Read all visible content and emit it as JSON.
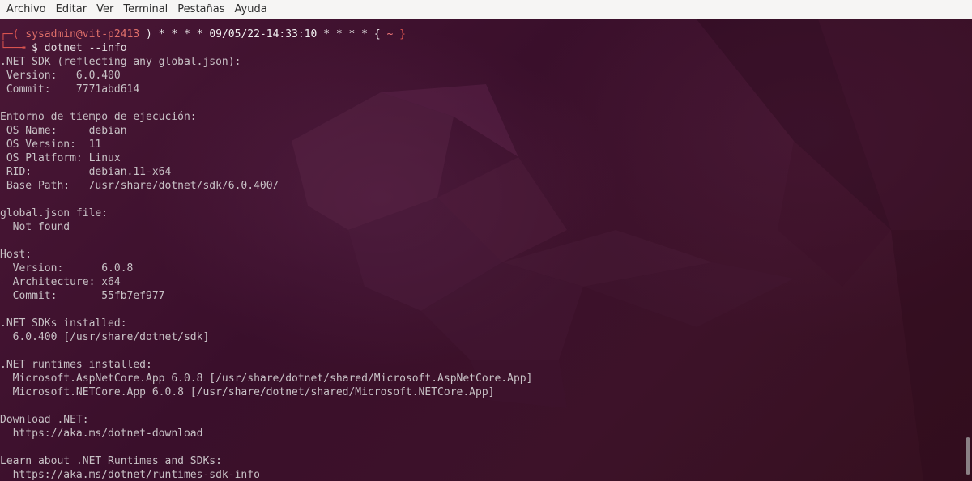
{
  "menu": [
    "Archivo",
    "Editar",
    "Ver",
    "Terminal",
    "Pestañas",
    "Ayuda"
  ],
  "prompt": {
    "frame_top": "┌─",
    "open": "( ",
    "user_host": "sysadmin@vit-p2413",
    "close": " )",
    "stars_left": " * * * * ",
    "datetime": "09/05/22-14:33:10",
    "stars_right": " * * * * ",
    "brace_open": "{ ",
    "tilde": "~",
    "brace_close": " }",
    "frame_bottom": "└──╼",
    "dollar": " $ ",
    "command": "dotnet --info"
  },
  "output": [
    ".NET SDK (reflecting any global.json):",
    " Version:   6.0.400",
    " Commit:    7771abd614",
    "",
    "Entorno de tiempo de ejecución:",
    " OS Name:     debian",
    " OS Version:  11",
    " OS Platform: Linux",
    " RID:         debian.11-x64",
    " Base Path:   /usr/share/dotnet/sdk/6.0.400/",
    "",
    "global.json file:",
    "  Not found",
    "",
    "Host:",
    "  Version:      6.0.8",
    "  Architecture: x64",
    "  Commit:       55fb7ef977",
    "",
    ".NET SDKs installed:",
    "  6.0.400 [/usr/share/dotnet/sdk]",
    "",
    ".NET runtimes installed:",
    "  Microsoft.AspNetCore.App 6.0.8 [/usr/share/dotnet/shared/Microsoft.AspNetCore.App]",
    "  Microsoft.NETCore.App 6.0.8 [/usr/share/dotnet/shared/Microsoft.NETCore.App]",
    "",
    "Download .NET:",
    "  https://aka.ms/dotnet-download",
    "",
    "Learn about .NET Runtimes and SDKs:",
    "  https://aka.ms/dotnet/runtimes-sdk-info"
  ]
}
